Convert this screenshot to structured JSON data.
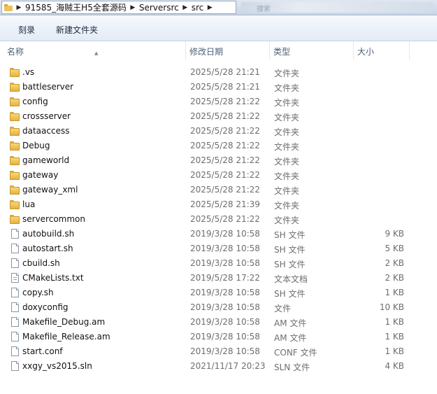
{
  "address_bar": {
    "crumbs": [
      "91585_海贼王H5全套源码",
      "Serversrc",
      "src"
    ],
    "search_placeholder": "搜索"
  },
  "toolbar": {
    "burn_label": "刻录",
    "new_folder_label": "新建文件夹"
  },
  "columns": {
    "name": "名称",
    "date": "修改日期",
    "type": "类型",
    "size": "大小"
  },
  "files": [
    {
      "icon": "folder-icon",
      "name": ".vs",
      "date": "2025/5/28 21:21",
      "type": "文件夹",
      "size": ""
    },
    {
      "icon": "folder-icon",
      "name": "battleserver",
      "date": "2025/5/28 21:21",
      "type": "文件夹",
      "size": ""
    },
    {
      "icon": "folder-icon",
      "name": "config",
      "date": "2025/5/28 21:22",
      "type": "文件夹",
      "size": ""
    },
    {
      "icon": "folder-icon",
      "name": "crossserver",
      "date": "2025/5/28 21:22",
      "type": "文件夹",
      "size": ""
    },
    {
      "icon": "folder-icon",
      "name": "dataaccess",
      "date": "2025/5/28 21:22",
      "type": "文件夹",
      "size": ""
    },
    {
      "icon": "folder-icon",
      "name": "Debug",
      "date": "2025/5/28 21:22",
      "type": "文件夹",
      "size": ""
    },
    {
      "icon": "folder-icon",
      "name": "gameworld",
      "date": "2025/5/28 21:22",
      "type": "文件夹",
      "size": ""
    },
    {
      "icon": "folder-icon",
      "name": "gateway",
      "date": "2025/5/28 21:22",
      "type": "文件夹",
      "size": ""
    },
    {
      "icon": "folder-icon",
      "name": "gateway_xml",
      "date": "2025/5/28 21:22",
      "type": "文件夹",
      "size": ""
    },
    {
      "icon": "folder-icon",
      "name": "lua",
      "date": "2025/5/28 21:39",
      "type": "文件夹",
      "size": ""
    },
    {
      "icon": "folder-icon",
      "name": "servercommon",
      "date": "2025/5/28 21:22",
      "type": "文件夹",
      "size": ""
    },
    {
      "icon": "file-icon",
      "name": "autobuild.sh",
      "date": "2019/3/28 10:58",
      "type": "SH 文件",
      "size": "9 KB"
    },
    {
      "icon": "file-icon",
      "name": "autostart.sh",
      "date": "2019/3/28 10:58",
      "type": "SH 文件",
      "size": "5 KB"
    },
    {
      "icon": "file-icon",
      "name": "cbuild.sh",
      "date": "2019/3/28 10:58",
      "type": "SH 文件",
      "size": "2 KB"
    },
    {
      "icon": "text-file-icon",
      "name": "CMakeLists.txt",
      "date": "2019/5/28 17:22",
      "type": "文本文档",
      "size": "2 KB"
    },
    {
      "icon": "file-icon",
      "name": "copy.sh",
      "date": "2019/3/28 10:58",
      "type": "SH 文件",
      "size": "1 KB"
    },
    {
      "icon": "file-icon",
      "name": "doxyconfig",
      "date": "2019/3/28 10:58",
      "type": "文件",
      "size": "10 KB"
    },
    {
      "icon": "file-icon",
      "name": "Makefile_Debug.am",
      "date": "2019/3/28 10:58",
      "type": "AM 文件",
      "size": "1 KB"
    },
    {
      "icon": "file-icon",
      "name": "Makefile_Release.am",
      "date": "2019/3/28 10:58",
      "type": "AM 文件",
      "size": "1 KB"
    },
    {
      "icon": "file-icon",
      "name": "start.conf",
      "date": "2019/3/28 10:58",
      "type": "CONF 文件",
      "size": "1 KB"
    },
    {
      "icon": "file-icon",
      "name": "xxgy_vs2015.sln",
      "date": "2021/11/17 20:23",
      "type": "SLN 文件",
      "size": "4 KB"
    }
  ],
  "colors": {
    "folder": "#e4b33f",
    "header_text": "#4c607a",
    "toolbar_bg": "#e3ebf5"
  }
}
